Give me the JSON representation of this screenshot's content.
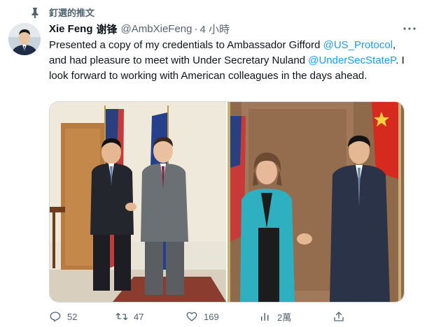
{
  "pinned": {
    "label": "釘選的推文",
    "icon": "pin-icon"
  },
  "author": {
    "display_name": "Xie Feng",
    "chinese_name": "谢锋",
    "handle": "@AmbXieFeng",
    "separator": "·",
    "time": "4 小時"
  },
  "tweet": {
    "part1": "Presented a copy of my credentials to Ambassador Gifford ",
    "mention1": "@US_Protocol",
    "part2": ", and had pleasure to meet with Under Secretary Nuland ",
    "mention2": "@UnderSecStateP",
    "part3": ". I look forward to working with American colleagues in the days ahead."
  },
  "actions": {
    "reply_count": "52",
    "retweet_count": "47",
    "like_count": "169",
    "views_count": "2萬"
  },
  "colors": {
    "link": "#1d9bf0",
    "secondary_text": "#536471",
    "primary_text": "#0f1419",
    "border": "#cfd9de"
  }
}
